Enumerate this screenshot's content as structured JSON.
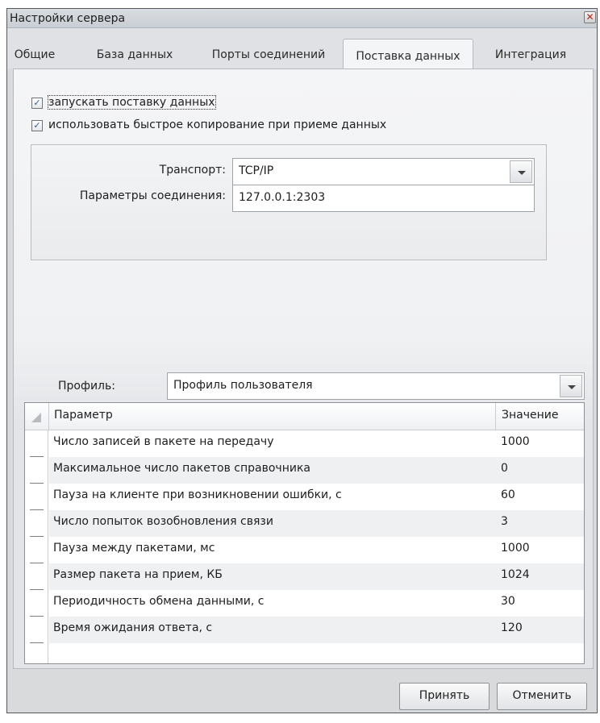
{
  "window": {
    "title": "Настройки сервера",
    "close_glyph": "✕"
  },
  "tabs": [
    {
      "label": "Общие"
    },
    {
      "label": "База данных"
    },
    {
      "label": "Порты соединений"
    },
    {
      "label": "Поставка данных",
      "active": true
    },
    {
      "label": "Интеграция"
    }
  ],
  "options": {
    "start_delivery": {
      "label": "запускать поставку данных",
      "checked": true
    },
    "fast_copy": {
      "label": "использовать быстрое копирование при приеме данных",
      "checked": true
    }
  },
  "transport": {
    "label": "Транспорт:",
    "value": "TCP/IP",
    "params_label": "Параметры соединения:",
    "params_value": "127.0.0.1:2303"
  },
  "profile": {
    "label": "Профиль:",
    "value": "Профиль пользователя"
  },
  "grid": {
    "col_param": "Параметр",
    "col_value": "Значение",
    "rows": [
      {
        "name": "Число записей в пакете на передачу",
        "value": "1000"
      },
      {
        "name": "Максимальное число пакетов справочника",
        "value": "0"
      },
      {
        "name": "Пауза на клиенте при возникновении ошибки, с",
        "value": "60"
      },
      {
        "name": "Число попыток возобновления связи",
        "value": "3"
      },
      {
        "name": "Пауза между пакетами, мс",
        "value": "1000"
      },
      {
        "name": "Размер пакета на прием, КБ",
        "value": "1024"
      },
      {
        "name": "Периодичность обмена данными, с",
        "value": "30"
      },
      {
        "name": "Время ожидания ответа, с",
        "value": "120"
      }
    ]
  },
  "buttons": {
    "apply": "Принять",
    "cancel": "Отменить"
  },
  "icons": {
    "check": "✓"
  }
}
